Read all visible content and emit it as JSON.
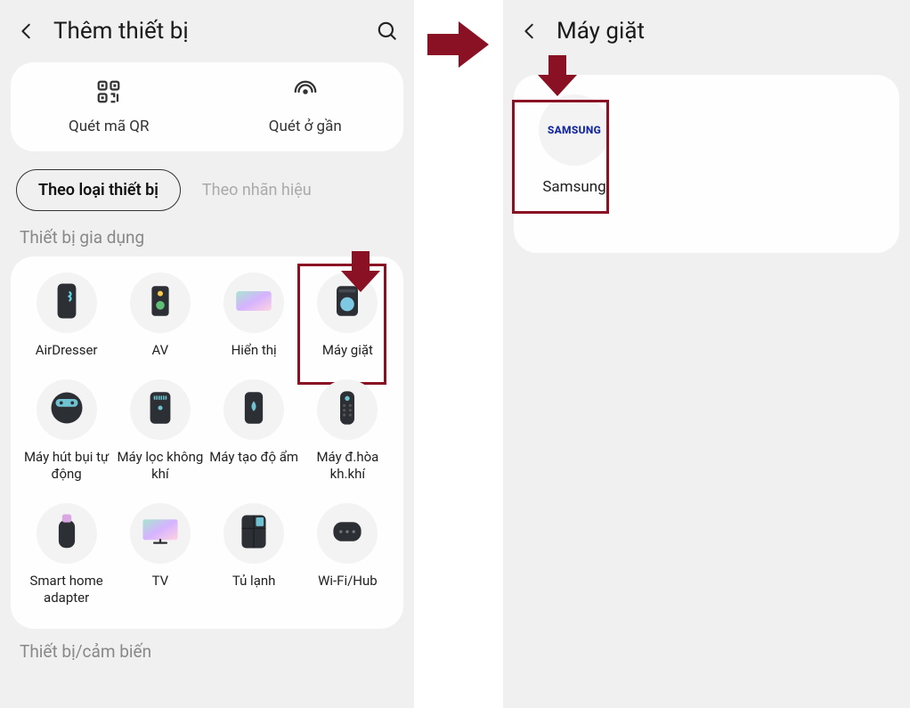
{
  "leftHeader": {
    "title": "Thêm thiết bị"
  },
  "rightHeader": {
    "title": "Máy giặt"
  },
  "scan": {
    "qr": "Quét mã QR",
    "nearby": "Quét ở gần"
  },
  "tabs": {
    "byType": "Theo loại thiết bị",
    "byBrand": "Theo nhãn hiệu"
  },
  "section1": "Thiết bị gia dụng",
  "devices": [
    {
      "label": "AirDresser",
      "icon": "airdresser"
    },
    {
      "label": "AV",
      "icon": "av"
    },
    {
      "label": "Hiển thị",
      "icon": "display"
    },
    {
      "label": "Máy giặt",
      "icon": "washer",
      "highlight": true
    },
    {
      "label": "Máy hút bụi tự động",
      "icon": "robot-vacuum"
    },
    {
      "label": "Máy lọc không khí",
      "icon": "air-purifier"
    },
    {
      "label": "Máy tạo độ ẩm",
      "icon": "humidifier"
    },
    {
      "label": "Máy đ.hòa kh.khí",
      "icon": "ac-remote"
    },
    {
      "label": "Smart home adapter",
      "icon": "adapter"
    },
    {
      "label": "TV",
      "icon": "tv"
    },
    {
      "label": "Tủ lạnh",
      "icon": "fridge"
    },
    {
      "label": "Wi-Fi/Hub",
      "icon": "hub"
    }
  ],
  "section2": "Thiết bị/cảm biến",
  "brand": {
    "logo": "SAMSUNG",
    "label": "Samsung"
  },
  "colors": {
    "highlight": "#8a1023",
    "samsungBlue": "#1428a0"
  }
}
